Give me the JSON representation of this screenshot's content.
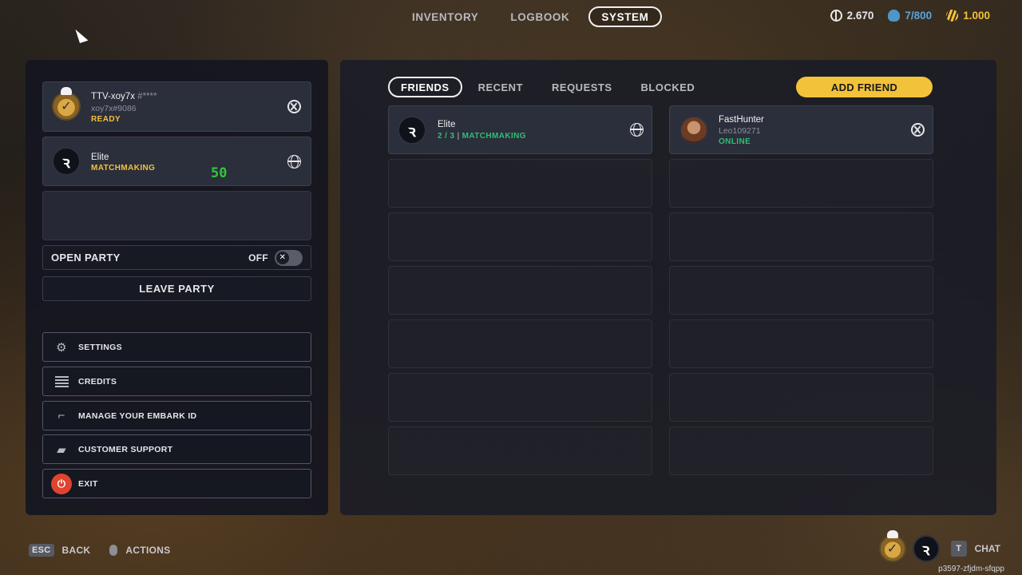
{
  "top_nav": {
    "tabs": [
      {
        "label": "INVENTORY"
      },
      {
        "label": "LOGBOOK"
      },
      {
        "label": "SYSTEM",
        "active": true
      }
    ]
  },
  "currencies": {
    "coins": "2.670",
    "capacity": "7/800",
    "raider_tokens": "1.000"
  },
  "party": {
    "members": [
      {
        "name": "TTV-xoy7x",
        "tag_mask": "#****",
        "handle": "xoy7x#9086",
        "status": "READY",
        "platform_icon": "xbox-icon"
      },
      {
        "name": "Elite",
        "status": "MATCHMAKING",
        "counter": "50",
        "platform_icon": "globe-icon"
      }
    ],
    "open_party_label": "OPEN PARTY",
    "open_party_state": "OFF",
    "leave_party_label": "LEAVE PARTY"
  },
  "menu": {
    "items": [
      {
        "label": "SETTINGS",
        "icon": "gear-icon"
      },
      {
        "label": "CREDITS",
        "icon": "list-icon"
      },
      {
        "label": "MANAGE YOUR EMBARK ID",
        "icon": "embark-id-icon"
      },
      {
        "label": "CUSTOMER SUPPORT",
        "icon": "chat-bubbles-icon"
      },
      {
        "label": "EXIT",
        "icon": "power-icon"
      }
    ]
  },
  "social": {
    "tabs": [
      {
        "label": "FRIENDS",
        "active": true
      },
      {
        "label": "RECENT"
      },
      {
        "label": "REQUESTS"
      },
      {
        "label": "BLOCKED"
      }
    ],
    "add_friend_label": "ADD FRIEND",
    "friends": [
      {
        "name": "Elite",
        "party_count": "2 / 3",
        "status": "MATCHMAKING",
        "platform_icon": "globe-icon"
      },
      {
        "name": "FastHunter",
        "handle": "Leo109271",
        "status": "ONLINE",
        "platform_icon": "xbox-icon"
      }
    ]
  },
  "footer": {
    "back_key": "ESC",
    "back_label": "BACK",
    "actions_label": "ACTIONS",
    "chat_key": "T",
    "chat_label": "CHAT",
    "build_id": "p3597-zfjdm-sfqpp"
  },
  "colors": {
    "accent_yellow": "#f2c23a",
    "online_green": "#2fbf74",
    "exit_red": "#e0442f",
    "panel_bg": "#14161f"
  }
}
